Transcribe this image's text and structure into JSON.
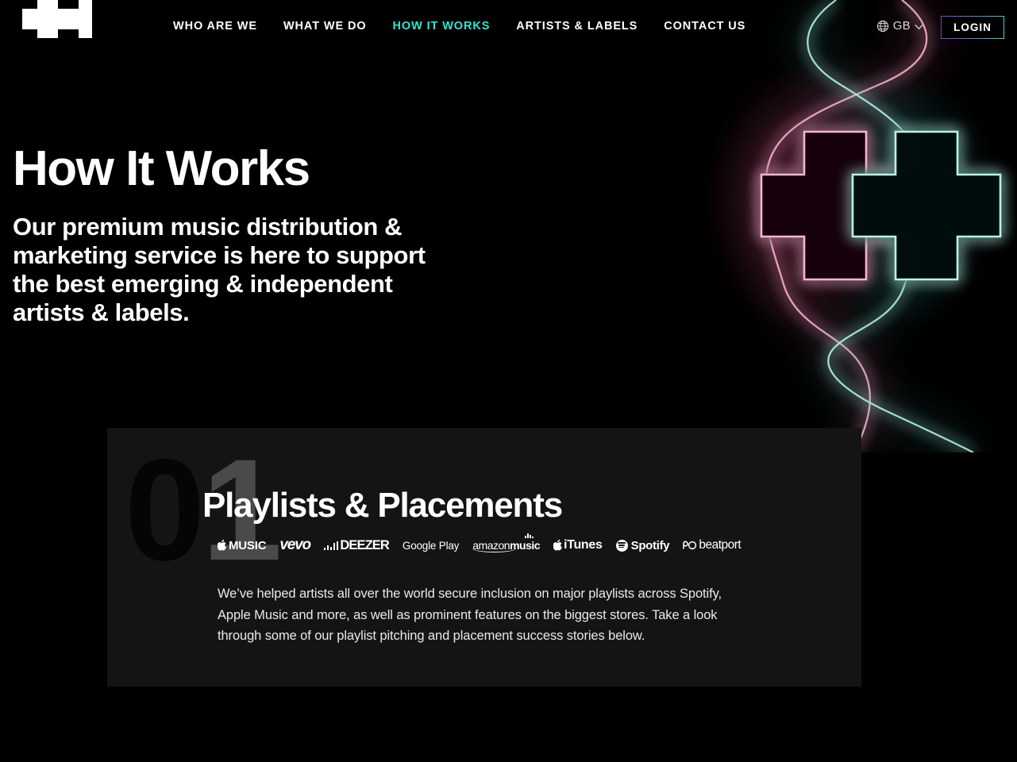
{
  "header": {
    "logo": {
      "icon": "double-cross-logo",
      "alt": "Double Cross Logo"
    },
    "nav_items": [
      {
        "label": "WHO ARE WE",
        "active": false
      },
      {
        "label": "WHAT WE DO",
        "active": false
      },
      {
        "label": "HOW IT WORKS",
        "active": true
      },
      {
        "label": "ARTISTS & LABELS",
        "active": false
      },
      {
        "label": "CONTACT US",
        "active": false
      }
    ],
    "language": {
      "icon": "globe-icon",
      "value": "GB",
      "chevron": "chevron-down-icon"
    },
    "login_label": "LOGIN"
  },
  "hero": {
    "title": "How It Works",
    "subtitle": "Our premium music distribution & marketing service is here to support the best emerging & independent artists & labels.",
    "art": {
      "name": "neon-crosses-graphic",
      "cross_left_color": "#f7b4cf",
      "cross_right_color": "#b8f2e6",
      "ribbon_pink": "#e8a0c0",
      "ribbon_teal": "#9fe3d6"
    }
  },
  "section": {
    "step_number_dark": "0",
    "step_number_light": "1",
    "title": "Playlists & Placements",
    "paragraph": "We’ve helped artists all over the world secure inclusion on major playlists across Spotify, Apple Music and more, as well as prominent features on the biggest stores. Take a look through some of our playlist pitching and placement success stories below.",
    "platform_logos": [
      {
        "name": "apple-music-logo",
        "label": "MUSIC"
      },
      {
        "name": "vevo-logo",
        "label": "vevo"
      },
      {
        "name": "deezer-logo",
        "label": "DEEZER"
      },
      {
        "name": "google-play-logo",
        "label": "Google Play"
      },
      {
        "name": "amazon-music-logo",
        "label_a": "amazon",
        "label_b": "music"
      },
      {
        "name": "itunes-logo",
        "label": "iTunes"
      },
      {
        "name": "spotify-logo",
        "label": "Spotify"
      },
      {
        "name": "beatport-logo",
        "label": "beatport"
      }
    ]
  },
  "colors": {
    "background": "#000000",
    "card_background": "#141414",
    "accent_teal": "#2fe6cf",
    "text_primary": "#ffffff"
  }
}
